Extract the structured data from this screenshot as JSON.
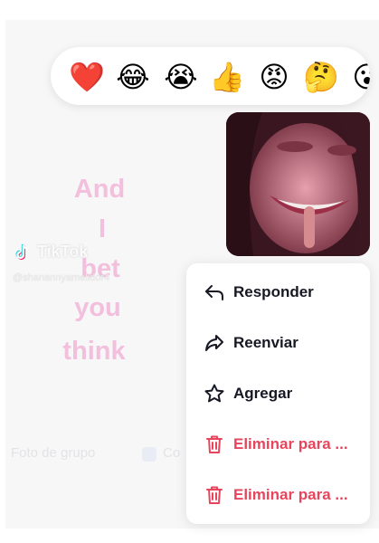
{
  "background_video": {
    "lyrics": [
      "And",
      "I",
      "bet",
      "you",
      "think"
    ],
    "watermark": {
      "brand": "TikTok",
      "username": "@shanannyamelidor4"
    }
  },
  "faded_footer": {
    "left_text": "Foto de grupo",
    "right_text": "Co"
  },
  "reactions": [
    {
      "emoji": "❤️",
      "icon": "heart-emoji"
    },
    {
      "emoji": "😂",
      "icon": "tears-of-joy-emoji"
    },
    {
      "emoji": "😭",
      "icon": "loudly-crying-emoji"
    },
    {
      "emoji": "👍",
      "icon": "thumbs-up-emoji"
    },
    {
      "emoji": "😡",
      "icon": "angry-face-emoji"
    },
    {
      "emoji": "🤔",
      "icon": "thinking-face-emoji"
    },
    {
      "emoji": "😮",
      "icon": "partially-visible-emoji"
    }
  ],
  "message": {
    "type": "image",
    "description_icon": "photo-message"
  },
  "context_menu": {
    "items": [
      {
        "label": "Responder",
        "icon": "reply-icon",
        "danger": false
      },
      {
        "label": "Reenviar",
        "icon": "forward-icon",
        "danger": false
      },
      {
        "label": "Agregar",
        "icon": "star-icon",
        "danger": false
      },
      {
        "label": "Eliminar para ...",
        "icon": "trash-icon",
        "danger": true
      },
      {
        "label": "Eliminar para ...",
        "icon": "trash-icon",
        "danger": true
      }
    ]
  },
  "colors": {
    "danger": "#e8455c",
    "text": "#161823",
    "lyric": "#f2bfdc",
    "accent": "#ffffff"
  }
}
